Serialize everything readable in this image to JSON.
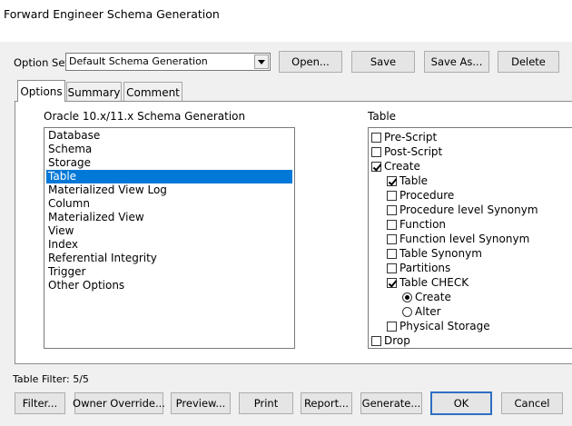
{
  "window": {
    "title": "Forward Engineer Schema Generation"
  },
  "option_set": {
    "label": "Option Set:",
    "value": "Default Schema Generation",
    "open_label": "Open...",
    "save_label": "Save",
    "save_as_label": "Save As...",
    "delete_label": "Delete"
  },
  "tabs": [
    {
      "label": "Options",
      "active": true
    },
    {
      "label": "Summary",
      "active": false
    },
    {
      "label": "Comment",
      "active": false
    }
  ],
  "left_panel": {
    "heading": "Oracle 10.x/11.x Schema Generation",
    "items": [
      "Database",
      "Schema",
      "Storage",
      "Table",
      "Materialized View Log",
      "Column",
      "Materialized View",
      "View",
      "Index",
      "Referential Integrity",
      "Trigger",
      "Other Options"
    ],
    "selected": "Table"
  },
  "right_panel": {
    "heading": "Table",
    "items": [
      {
        "label": "Pre-Script",
        "type": "checkbox",
        "checked": false,
        "level": 0
      },
      {
        "label": "Post-Script",
        "type": "checkbox",
        "checked": false,
        "level": 0
      },
      {
        "label": "Create",
        "type": "checkbox",
        "checked": true,
        "level": 0
      },
      {
        "label": "Table",
        "type": "checkbox",
        "checked": true,
        "level": 1
      },
      {
        "label": "Procedure",
        "type": "checkbox",
        "checked": false,
        "level": 1
      },
      {
        "label": "Procedure level Synonym",
        "type": "checkbox",
        "checked": false,
        "level": 1
      },
      {
        "label": "Function",
        "type": "checkbox",
        "checked": false,
        "level": 1
      },
      {
        "label": "Function level Synonym",
        "type": "checkbox",
        "checked": false,
        "level": 1
      },
      {
        "label": "Table Synonym",
        "type": "checkbox",
        "checked": false,
        "level": 1
      },
      {
        "label": "Partitions",
        "type": "checkbox",
        "checked": false,
        "level": 1
      },
      {
        "label": "Table CHECK",
        "type": "checkbox",
        "checked": true,
        "level": 1
      },
      {
        "label": "Create",
        "type": "radio",
        "checked": true,
        "level": 2
      },
      {
        "label": "Alter",
        "type": "radio",
        "checked": false,
        "level": 2
      },
      {
        "label": "Physical Storage",
        "type": "checkbox",
        "checked": false,
        "level": 1
      },
      {
        "label": "Drop",
        "type": "checkbox",
        "checked": false,
        "level": 0
      }
    ]
  },
  "status": {
    "table_filter": "Table Filter: 5/5"
  },
  "bottom_buttons": {
    "filter": "Filter...",
    "owner_override": "Owner Override...",
    "preview": "Preview...",
    "print": "Print",
    "report": "Report...",
    "generate": "Generate...",
    "ok": "OK",
    "cancel": "Cancel"
  }
}
